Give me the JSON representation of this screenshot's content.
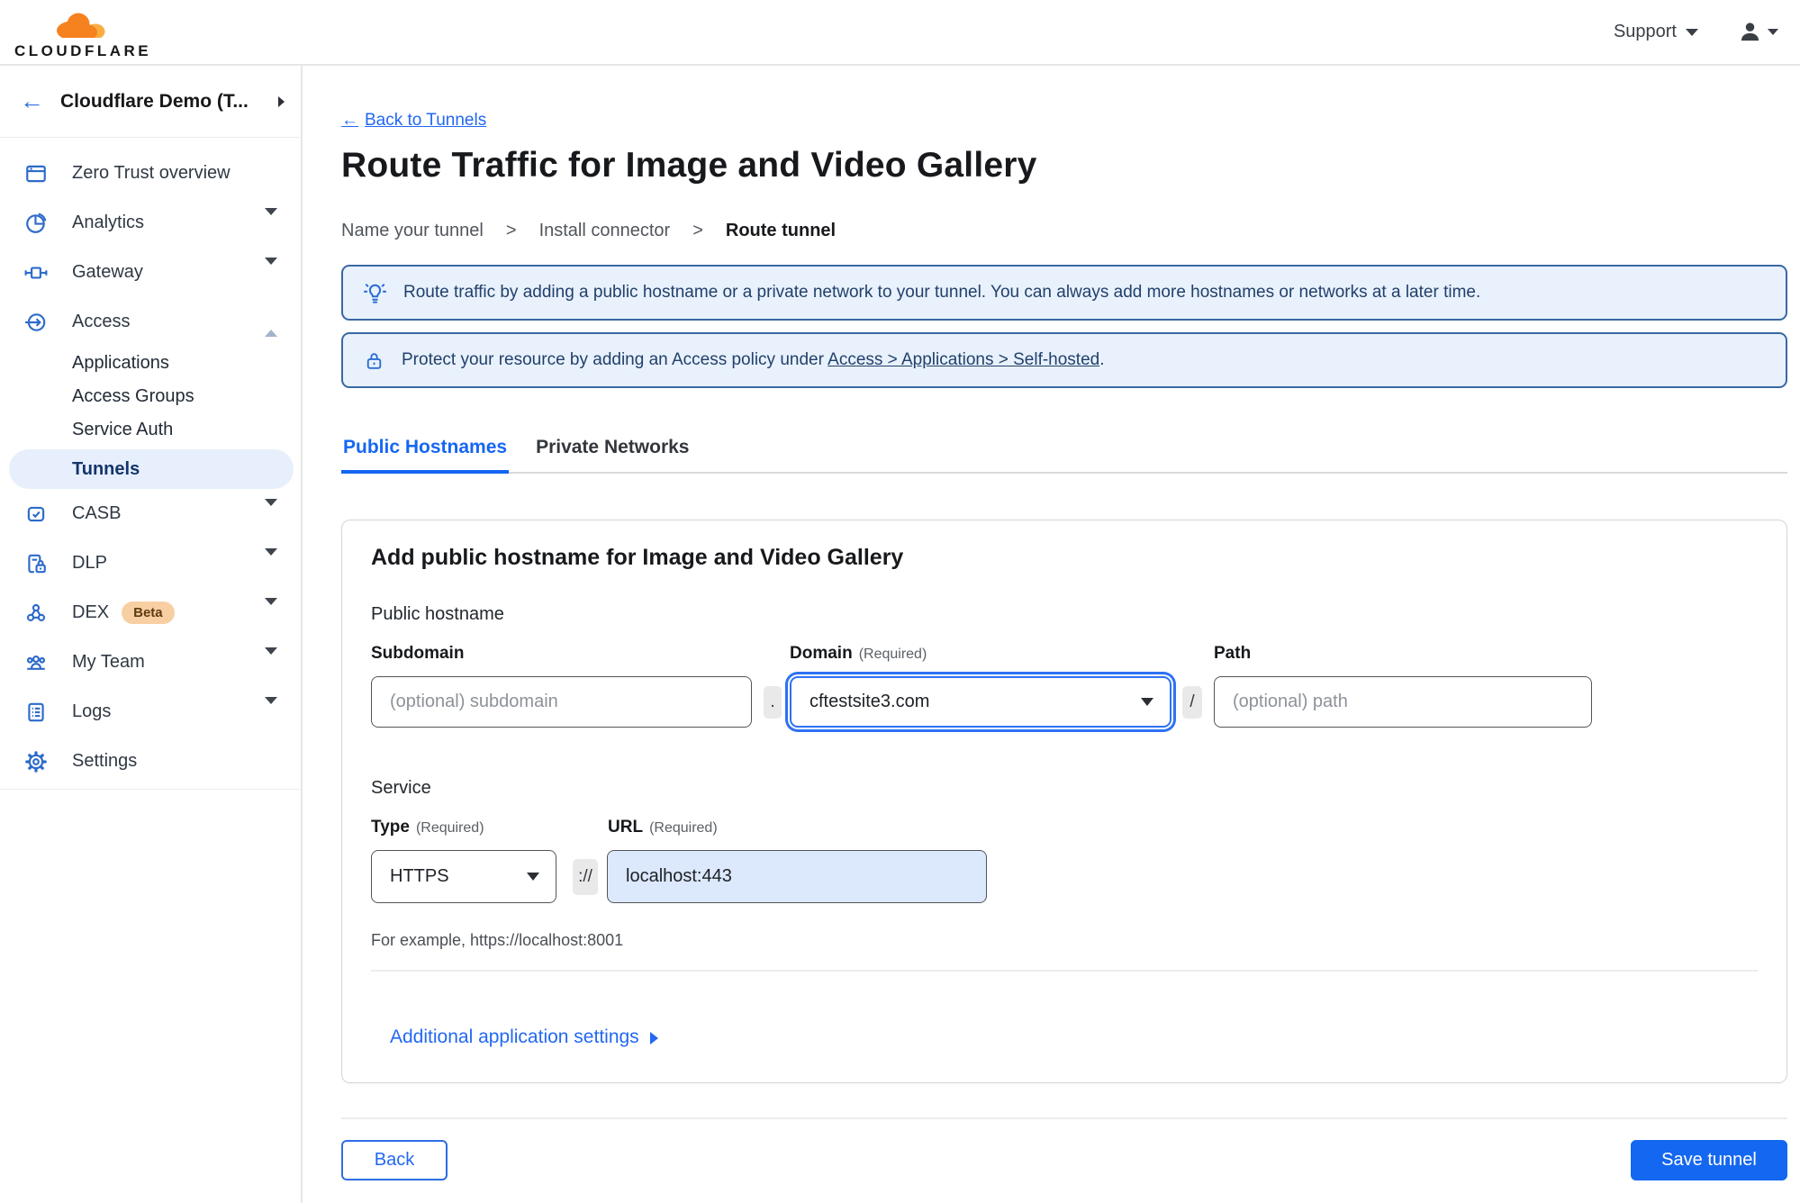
{
  "colors": {
    "accent_blue": "#1467f0",
    "link_blue": "#2268f2",
    "banner_bg": "#e8f1fc",
    "banner_border": "#3a68a4",
    "brand_orange": "#f6821f",
    "brand_orange_light": "#fbad41",
    "active_pill_bg": "#e7effc",
    "beta_badge_bg": "#f8cfa2"
  },
  "header": {
    "logo_text": "CLOUDFLARE",
    "support_label": "Support"
  },
  "sidebar": {
    "account_name": "Cloudflare Demo (T...",
    "back_arrow": "←",
    "items": [
      {
        "label": "Zero Trust overview"
      },
      {
        "label": "Analytics"
      },
      {
        "label": "Gateway"
      },
      {
        "label": "Access",
        "expanded": true
      },
      {
        "label": "CASB"
      },
      {
        "label": "DLP"
      },
      {
        "label": "DEX",
        "badge": "Beta"
      },
      {
        "label": "My Team"
      },
      {
        "label": "Logs"
      },
      {
        "label": "Settings"
      }
    ],
    "access_children": [
      {
        "label": "Applications"
      },
      {
        "label": "Access Groups"
      },
      {
        "label": "Service Auth"
      },
      {
        "label": "Tunnels",
        "active": true
      }
    ]
  },
  "main": {
    "back_arrow": "←",
    "back_link": "Back to Tunnels",
    "title": "Route Traffic for Image and Video Gallery",
    "steps": [
      {
        "label": "Name your tunnel"
      },
      {
        "label": "Install connector"
      },
      {
        "label": "Route tunnel",
        "current": true
      }
    ],
    "step_separator": ">",
    "banners": {
      "tip_text": "Route traffic by adding a public hostname or a private network to your tunnel. You can always add more hostnames or networks at a later time.",
      "access_prefix": "Protect your resource by adding an Access policy under ",
      "access_link": "Access > Applications > Self-hosted",
      "access_suffix": "."
    },
    "tabs": [
      {
        "label": "Public Hostnames",
        "active": true
      },
      {
        "label": "Private Networks"
      }
    ],
    "form": {
      "heading": "Add public hostname for Image and Video Gallery",
      "public_hostname_label": "Public hostname",
      "subdomain_label": "Subdomain",
      "subdomain_placeholder": "(optional) subdomain",
      "dot_separator": ".",
      "domain_label": "Domain",
      "required_note": "(Required)",
      "domain_value": "cftestsite3.com",
      "path_label": "Path",
      "slash_separator": "/",
      "path_placeholder": "(optional) path",
      "service_label": "Service",
      "type_label": "Type",
      "type_value": "HTTPS",
      "scheme_separator": "://",
      "url_label": "URL",
      "url_value": "localhost:443",
      "example_text": "For example, https://localhost:8001",
      "additional_settings_label": "Additional application settings"
    },
    "footer": {
      "back_label": "Back",
      "save_label": "Save tunnel"
    }
  }
}
